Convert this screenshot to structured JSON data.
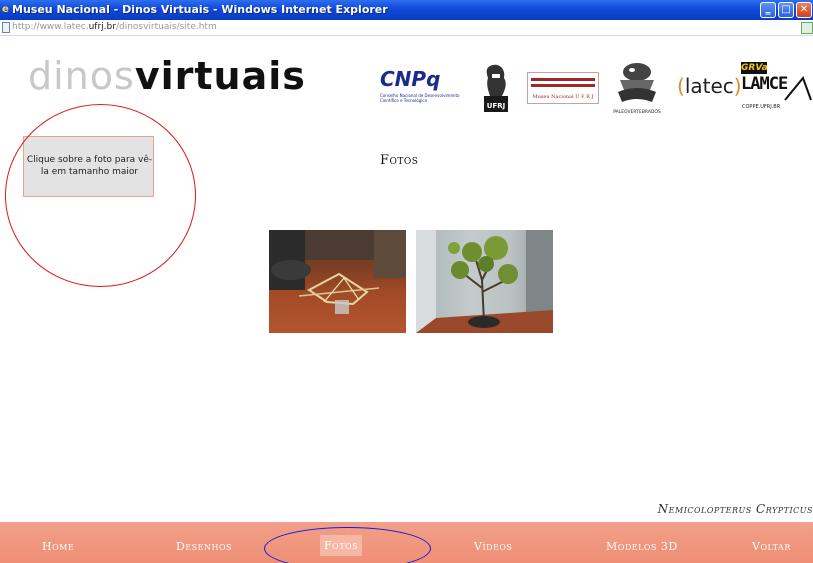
{
  "window": {
    "title": "Museu Nacional - Dinos Virtuais - Windows Internet Explorer",
    "url_prefix": "http://www.latec.",
    "url_domain": "ufrj.br",
    "url_path": "/dinosvirtuais/site.htm",
    "min_glyph": "‗",
    "max_glyph": "□",
    "close_glyph": "✕"
  },
  "header": {
    "logo_part1": "dinos",
    "logo_part2": "virtuais",
    "partners": {
      "cnpq": "CNPq",
      "cnpq_sub": "Conselho Nacional de Desenvolvimento Científico e Tecnológico",
      "ufrj": "UFRJ",
      "museu": "Museu Nacional",
      "museu_sub": "U F R J",
      "paleo": "PALEOVERTEBRADOS",
      "latec_open": "(",
      "latec": "latec",
      "latec_close": ")",
      "grva": "GRVa",
      "lamce": "LAMCE",
      "coppe": "COPPE.UFRJ.BR"
    }
  },
  "hint": {
    "text": "Clique sobre a foto para vê-la em tamanho maior"
  },
  "content": {
    "title": "Fotos",
    "species": "Nemicolopterus Crypticus"
  },
  "nav": {
    "home": "Home",
    "desenhos": "Desenhos",
    "fotos": "Fotos",
    "videos": "Vídeos",
    "modelos": "Modelos 3D",
    "voltar": "Voltar"
  },
  "colors": {
    "nav_bg": "#ee8f75",
    "nav_active": "#f6b7a4",
    "highlight_red": "#e01818",
    "highlight_blue": "#1a1ad8"
  }
}
